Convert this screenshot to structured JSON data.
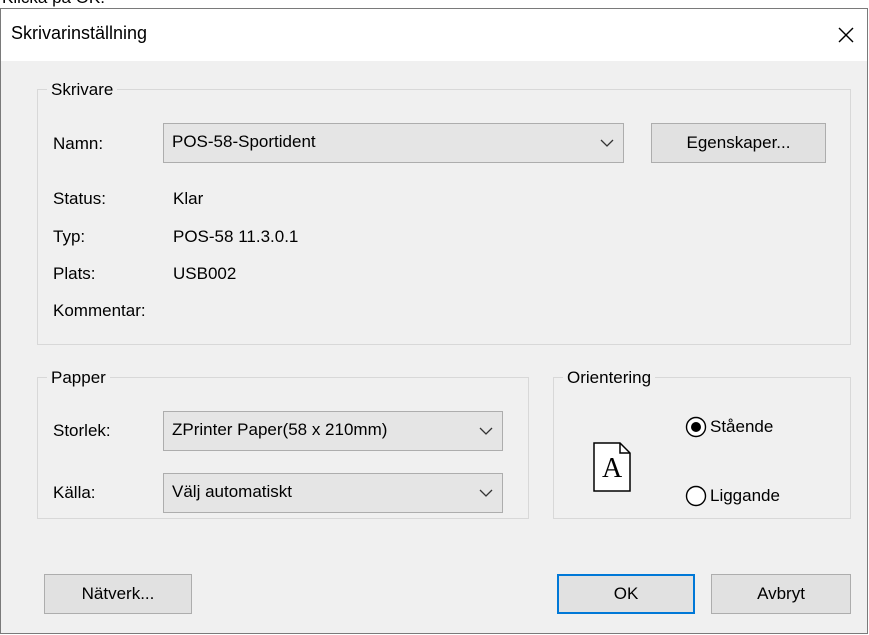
{
  "background": {
    "partial_text": "Klicka på OK."
  },
  "dialog": {
    "title": "Skrivarinställning",
    "close_icon": "close-icon"
  },
  "printer": {
    "group_label": "Skrivare",
    "name_label": "Namn:",
    "name_value": "POS-58-Sportident",
    "properties_button": "Egenskaper...",
    "status_label": "Status:",
    "status_value": "Klar",
    "type_label": "Typ:",
    "type_value": "POS-58 11.3.0.1",
    "location_label": "Plats:",
    "location_value": "USB002",
    "comment_label": "Kommentar:",
    "comment_value": ""
  },
  "paper": {
    "group_label": "Papper",
    "size_label": "Storlek:",
    "size_value": "ZPrinter Paper(58 x 210mm)",
    "source_label": "Källa:",
    "source_value": "Välj automatiskt"
  },
  "orientation": {
    "group_label": "Orientering",
    "page_icon_letter": "A",
    "portrait_label": "Stående",
    "landscape_label": "Liggande",
    "selected": "portrait"
  },
  "buttons": {
    "network": "Nätverk...",
    "ok": "OK",
    "cancel": "Avbryt"
  },
  "colors": {
    "dialog_bg": "#f0f0f0",
    "default_button_border": "#0078d7",
    "button_bg": "#e1e1e1"
  }
}
